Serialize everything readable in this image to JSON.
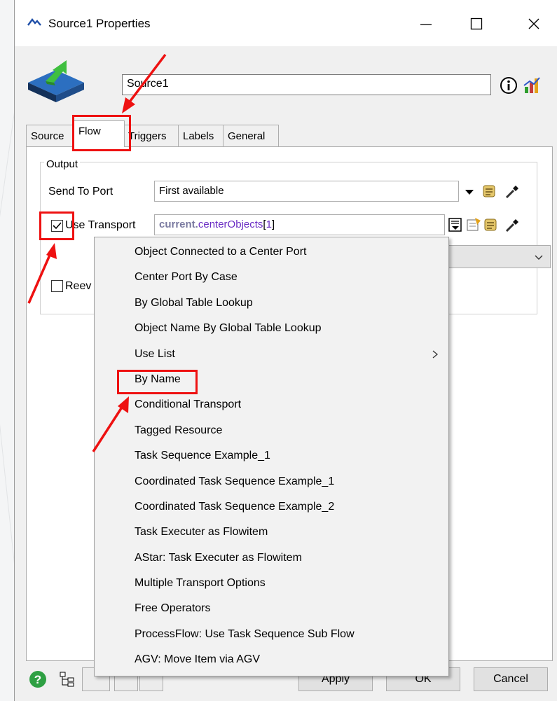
{
  "window": {
    "title": "Source1  Properties",
    "controls": {
      "minimize": "minimize-icon",
      "maximize": "maximize-icon",
      "close": "close-icon"
    }
  },
  "object": {
    "name": "Source1"
  },
  "tabs": [
    {
      "label": "Source"
    },
    {
      "label": "Flow",
      "active": true
    },
    {
      "label": "Triggers"
    },
    {
      "label": "Labels"
    },
    {
      "label": "General"
    }
  ],
  "output": {
    "group_label": "Output",
    "send_to_port": {
      "label": "Send To Port",
      "value": "First available"
    },
    "use_transport": {
      "label": "Use Transport",
      "checked": true,
      "code_keyword": "current.",
      "code_member": "centerObjects",
      "code_open": "[",
      "code_index": "1",
      "code_close": "]"
    },
    "reevaluate": {
      "label": "Reev",
      "checked": false
    }
  },
  "dropdown_menu": {
    "items": [
      {
        "label": "Object Connected to a Center Port"
      },
      {
        "label": "Center Port By Case"
      },
      {
        "label": "By Global Table Lookup"
      },
      {
        "label": "Object Name By Global Table Lookup"
      },
      {
        "label": "Use List",
        "has_submenu": true
      },
      {
        "label": "By Name",
        "highlighted": true
      },
      {
        "label": "Conditional Transport"
      },
      {
        "label": "Tagged Resource"
      },
      {
        "label": "Task Sequence Example_1"
      },
      {
        "label": "Coordinated Task Sequence Example_1"
      },
      {
        "label": "Coordinated Task Sequence Example_2"
      },
      {
        "label": "Task Executer as Flowitem"
      },
      {
        "label": "AStar: Task Executer as Flowitem"
      },
      {
        "label": "Multiple Transport Options"
      },
      {
        "label": "Free Operators"
      },
      {
        "label": "ProcessFlow: Use Task Sequence Sub Flow"
      },
      {
        "label": "AGV: Move Item via AGV"
      }
    ]
  },
  "footer": {
    "apply_label": "Apply",
    "ok_label": "OK",
    "cancel_label": "Cancel"
  },
  "annotation_color": "#ee1111"
}
